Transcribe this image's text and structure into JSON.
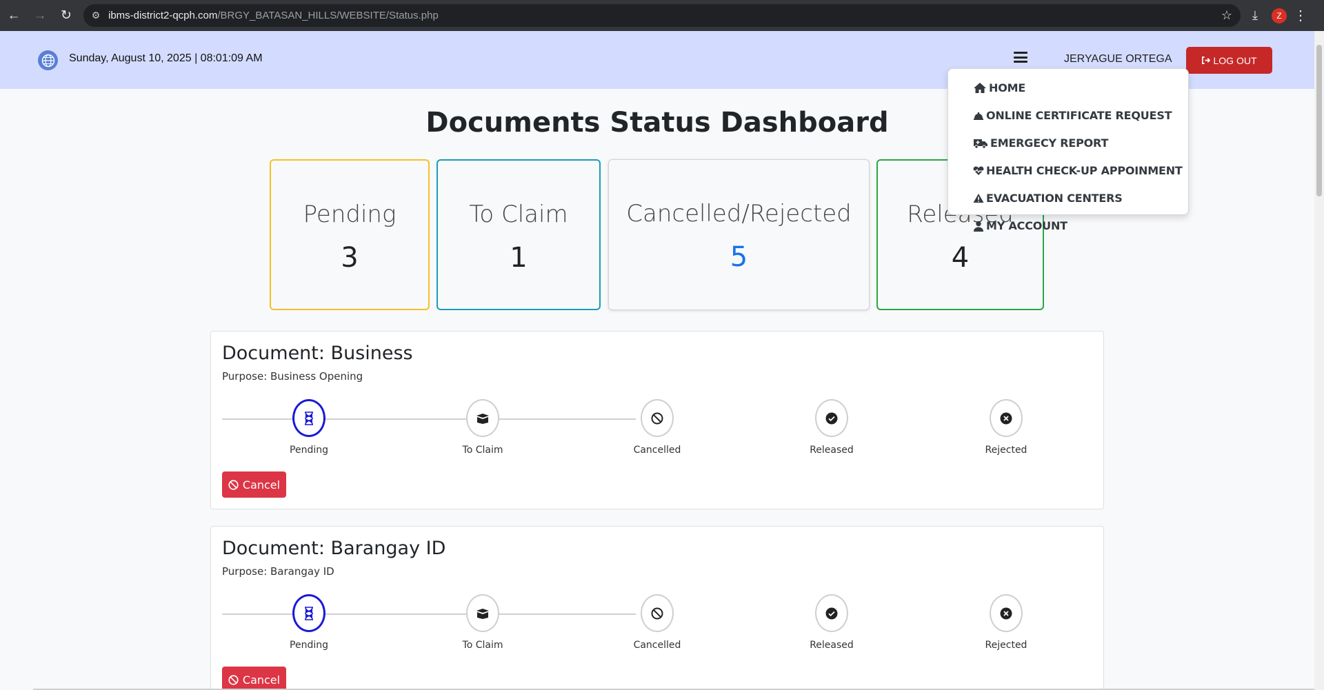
{
  "browser": {
    "url_host": "ibms-district2-qcph.com",
    "url_path": "/BRGY_BATASAN_HILLS/WEBSITE/Status.php",
    "profile_initial": "Z"
  },
  "header": {
    "datetime": "Sunday, August 10, 2025 | 08:01:09 AM",
    "username": "JERYAGUE ORTEGA",
    "logout_label": "LOG OUT"
  },
  "page_title": "Documents Status Dashboard",
  "stats": [
    {
      "label": "Pending",
      "value": "3"
    },
    {
      "label": "To Claim",
      "value": "1"
    },
    {
      "label": "Cancelled/Rejected",
      "value": "5"
    },
    {
      "label": "Released",
      "value": "4"
    }
  ],
  "documents": [
    {
      "title": "Document: Business",
      "purpose": "Purpose: Business Opening",
      "steps": [
        "Pending",
        "To Claim",
        "Cancelled",
        "Released",
        "Rejected"
      ],
      "active_step": "Pending",
      "cancel_label": "Cancel"
    },
    {
      "title": "Document: Barangay ID",
      "purpose": "Purpose: Barangay ID",
      "steps": [
        "Pending",
        "To Claim",
        "Cancelled",
        "Released",
        "Rejected"
      ],
      "active_step": "Pending",
      "cancel_label": "Cancel"
    }
  ],
  "menu": {
    "items": [
      {
        "label": "HOME",
        "icon": "home-icon"
      },
      {
        "label": "ONLINE CERTIFICATE REQUEST",
        "icon": "bell-icon"
      },
      {
        "label": "EMERGECY REPORT",
        "icon": "ambulance-icon"
      },
      {
        "label": "HEALTH CHECK-UP APPOINMENT",
        "icon": "heart-pulse-icon"
      },
      {
        "label": "EVACUATION CENTERS",
        "icon": "warning-icon"
      },
      {
        "label": "MY ACCOUNT",
        "icon": "user-icon"
      }
    ]
  },
  "colors": {
    "header_bg": "#d3dcff",
    "logout_red": "#c62828",
    "cancel_red": "#dc3545",
    "pending_border": "#f3c12a",
    "toclaim_border": "#1a9db3",
    "released_border": "#28a745",
    "active_step": "#1a1ad6",
    "cancelled_value": "#1a73e8"
  }
}
